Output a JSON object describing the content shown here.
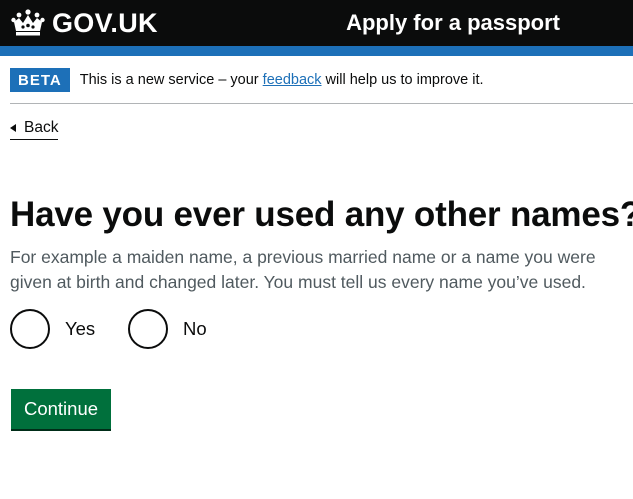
{
  "header": {
    "logo_text": "GOV.UK",
    "service_name": "Apply for a passport",
    "logo_icon": "crown-icon",
    "colors": {
      "header_bg": "#0b0c0c",
      "stripe": "#1d70b8"
    }
  },
  "phase_banner": {
    "tag": "BETA",
    "text_before": "This is a new service – your ",
    "link_text": "feedback",
    "text_after": " will help us to improve it."
  },
  "back_link": {
    "label": "Back",
    "icon": "chevron-left-icon"
  },
  "question": {
    "heading": "Have you ever used any other names?",
    "hint": "For example a maiden name, a previous married name or a name you were given at birth and changed later. You must tell us every name you’ve used.",
    "options": [
      {
        "label": "Yes",
        "selected": false
      },
      {
        "label": "No",
        "selected": false
      }
    ]
  },
  "actions": {
    "continue_label": "Continue",
    "colors": {
      "button": "#00703c"
    }
  }
}
